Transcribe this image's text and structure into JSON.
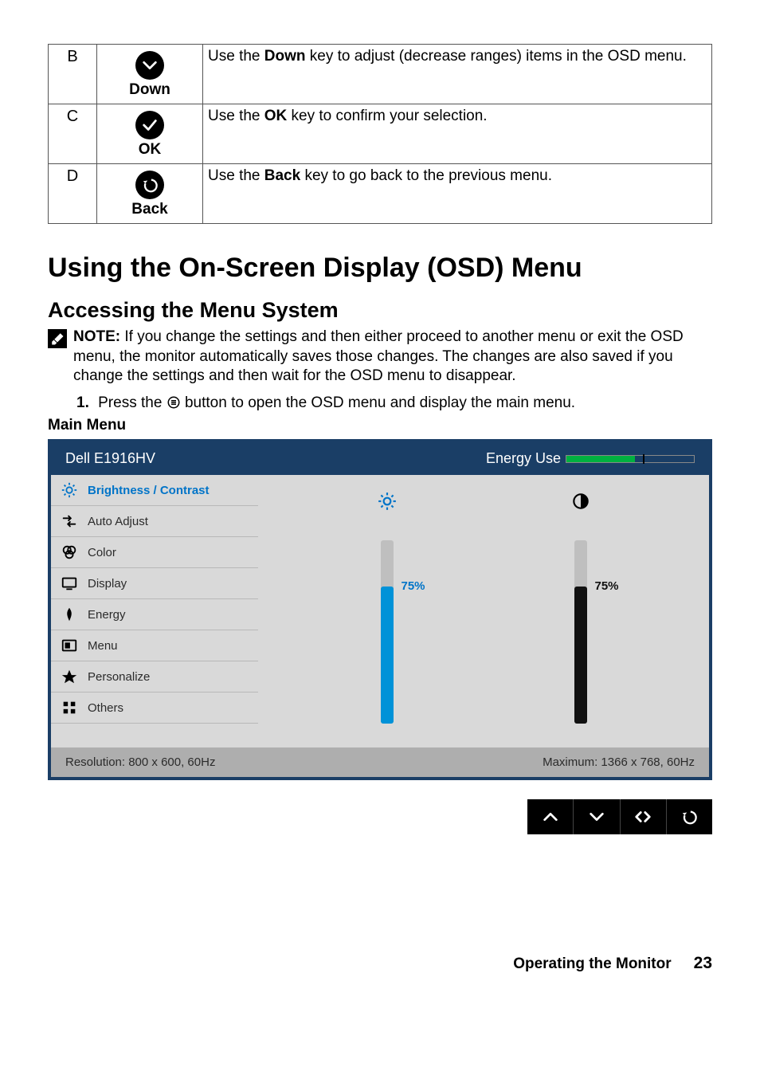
{
  "key_table": {
    "rows": [
      {
        "letter": "B",
        "icon_name": "chevron-down-icon",
        "icon_label": "Down",
        "desc_prefix": "Use the ",
        "desc_bold": "Down",
        "desc_suffix": " key to adjust (decrease ranges) items in the OSD menu."
      },
      {
        "letter": "C",
        "icon_name": "check-icon",
        "icon_label": "OK",
        "desc_prefix": "Use the ",
        "desc_bold": "OK",
        "desc_suffix": " key to confirm your selection."
      },
      {
        "letter": "D",
        "icon_name": "back-arrow-icon",
        "icon_label": "Back",
        "desc_prefix": "Use the ",
        "desc_bold": "Back",
        "desc_suffix": " key to go back to the previous menu."
      }
    ]
  },
  "section_title": "Using the On-Screen Display (OSD) Menu",
  "subsection_title": "Accessing the Menu System",
  "note": {
    "label": "NOTE:",
    "text": " If you change the settings and then either proceed to another menu or exit the OSD menu, the monitor automatically saves those changes. The changes are also saved if you change the settings and then wait for the OSD menu to disappear."
  },
  "step1": {
    "num": "1.",
    "before_icon": " Press the ",
    "after_icon": " button to open the OSD menu and display the main menu."
  },
  "main_menu_label": "Main Menu",
  "osd": {
    "model": "Dell E1916HV",
    "energy_label": "Energy Use",
    "energy_fill_pct": 54,
    "energy_tick_pct": 60,
    "menu_items": [
      {
        "label": "Brightness / Contrast",
        "icon": "brightness-icon",
        "selected": true
      },
      {
        "label": "Auto Adjust",
        "icon": "auto-adjust-icon",
        "selected": false
      },
      {
        "label": "Color",
        "icon": "color-icon",
        "selected": false
      },
      {
        "label": "Display",
        "icon": "display-icon",
        "selected": false
      },
      {
        "label": "Energy",
        "icon": "energy-icon",
        "selected": false
      },
      {
        "label": "Menu",
        "icon": "menu-icon",
        "selected": false
      },
      {
        "label": "Personalize",
        "icon": "personalize-icon",
        "selected": false
      },
      {
        "label": "Others",
        "icon": "others-icon",
        "selected": false
      }
    ],
    "sliders": {
      "brightness": {
        "value": 75,
        "label": "75%",
        "color": "blue"
      },
      "contrast": {
        "value": 75,
        "label": "75%",
        "color": "black"
      }
    },
    "footer_left": "Resolution: 800 x 600, 60Hz",
    "footer_right": "Maximum: 1366 x 768, 60Hz"
  },
  "buttons_strip": [
    "chevron-up-icon",
    "chevron-down-icon",
    "nav-lr-icon",
    "back-arrow-icon"
  ],
  "page_footer": {
    "title": "Operating the Monitor",
    "page": "23"
  }
}
